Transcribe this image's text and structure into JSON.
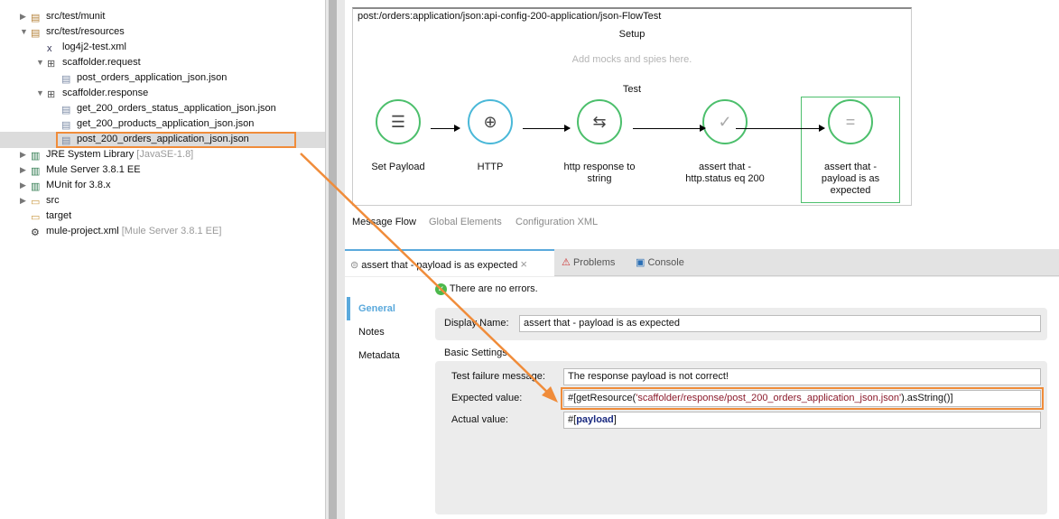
{
  "tree": [
    {
      "label": "src/test/munit",
      "icon": "package-folder-icon",
      "expanded": false
    },
    {
      "label": "src/test/resources",
      "icon": "package-folder-icon",
      "expanded": true
    },
    {
      "label": "log4j2-test.xml",
      "icon": "xml-file-icon"
    },
    {
      "label": "scaffolder.request",
      "icon": "package-icon",
      "expanded": true
    },
    {
      "label": "post_orders_application_json.json",
      "icon": "file-icon"
    },
    {
      "label": "scaffolder.response",
      "icon": "package-icon",
      "expanded": true
    },
    {
      "label": "get_200_orders_status_application_json.json",
      "icon": "file-icon"
    },
    {
      "label": "get_200_products_application_json.json",
      "icon": "file-icon"
    },
    {
      "label": "post_200_orders_application_json.json",
      "icon": "file-icon",
      "selected": true
    },
    {
      "label": "JRE System Library",
      "decoration": "[JavaSE-1.8]",
      "icon": "library-icon",
      "expanded": false
    },
    {
      "label": "Mule Server 3.8.1 EE",
      "icon": "library-icon",
      "expanded": false
    },
    {
      "label": "MUnit for 3.8.x",
      "icon": "library-icon",
      "expanded": false
    },
    {
      "label": "src",
      "icon": "folder-icon",
      "expanded": false
    },
    {
      "label": "target",
      "icon": "folder-icon"
    },
    {
      "label": "mule-project.xml",
      "decoration": "[Mule Server 3.8.1 EE]",
      "icon": "gear-icon"
    }
  ],
  "canvas": {
    "flow_name": "post:/orders:application/json:api-config-200-application/json-FlowTest",
    "setup_title": "Setup",
    "setup_hint": "Add mocks and spies here.",
    "test_title": "Test",
    "nodes": [
      {
        "label": "Set Payload",
        "icon": "set-payload-icon"
      },
      {
        "label": "HTTP",
        "icon": "globe-icon"
      },
      {
        "label": "http response to string",
        "icon": "transform-icon"
      },
      {
        "label": "assert that - http.status eq 200",
        "icon": "assert-check-icon"
      },
      {
        "label": "assert that - payload is as expected",
        "icon": "assert-equals-icon",
        "selected": true
      }
    ]
  },
  "view_tabs": [
    "Message Flow",
    "Global Elements",
    "Configuration XML"
  ],
  "panel": {
    "tabs": [
      "assert that - payload is as expected",
      "Problems",
      "Console"
    ],
    "status": "There are no errors.",
    "side_tabs": [
      "General",
      "Notes",
      "Metadata"
    ],
    "display_name_label": "Display Name:",
    "display_name_value": "assert that - payload is as expected",
    "section_title": "Basic Settings",
    "failure_label": "Test failure message:",
    "failure_value": "The response payload is not correct!",
    "expected_label": "Expected value:",
    "expected_parts": [
      "#[getResource(",
      "'scaffolder/response/post_200_orders_application_json.json'",
      ").asString()]"
    ],
    "actual_label": "Actual value:",
    "actual_parts": [
      "#[",
      "payload",
      "]"
    ]
  },
  "colors": {
    "accent_green": "#4cbf6c",
    "http_blue": "#4ab8d8",
    "highlight_orange": "#f08c3a",
    "string_red": "#8b1a2b",
    "keyword_blue": "#1a2a80"
  }
}
